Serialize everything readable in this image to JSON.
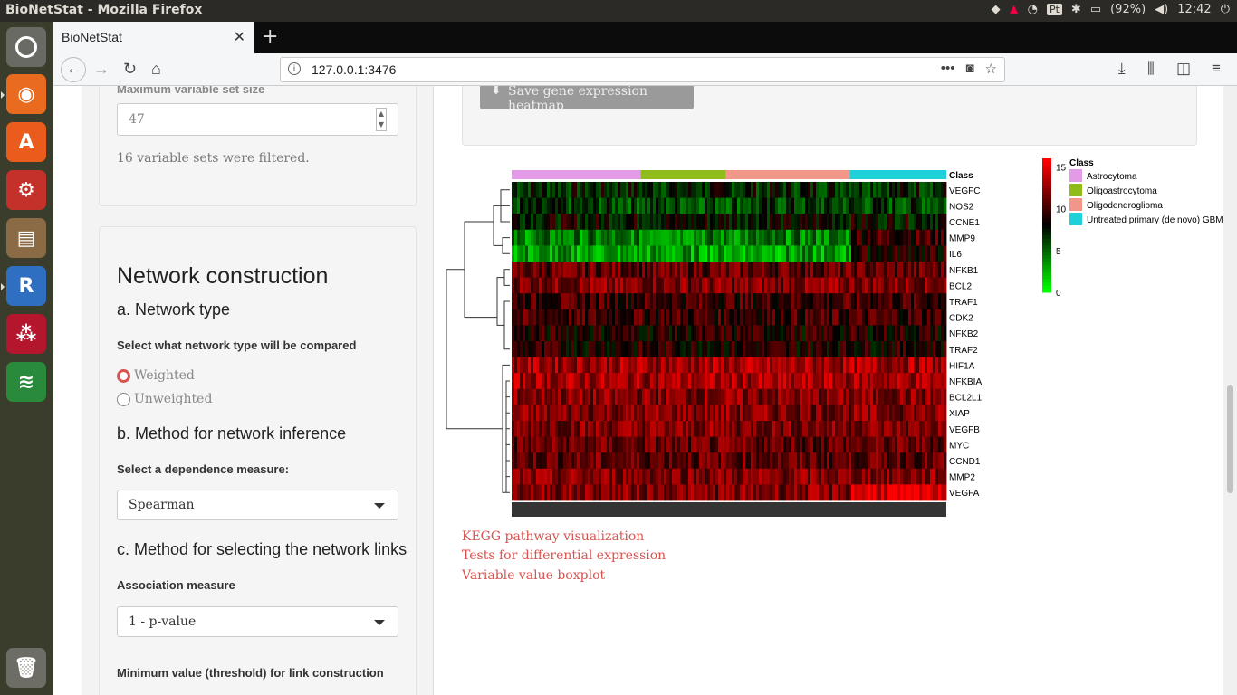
{
  "os": {
    "window_title": "BioNetStat - Mozilla Firefox",
    "battery": "(92%)",
    "clock": "12:42",
    "launcher": [
      "ubuntu-dash",
      "firefox",
      "software-center",
      "system-settings",
      "files",
      "r",
      "mendeley",
      "spotify",
      "trash"
    ]
  },
  "browser": {
    "tab_title": "BioNetStat",
    "url": "127.0.0.1:3476"
  },
  "sidebar": {
    "max_set_size_label": "Maximum variable set size",
    "max_set_size_value": "47",
    "filtered_text": "16 variable sets were filtered.",
    "section_title": "Network construction",
    "network_type_heading": "a. Network type",
    "network_type_prompt": "Select what network type will be compared",
    "network_type_options": [
      "Weighted",
      "Unweighted"
    ],
    "network_type_selected": "Weighted",
    "inference_heading": "b. Method for network inference",
    "dependence_prompt": "Select a dependence measure:",
    "dependence_value": "Spearman",
    "links_heading": "c. Method for selecting the network links",
    "association_label": "Association measure",
    "association_value": "1 - p-value",
    "threshold_label": "Minimum value (threshold) for link construction"
  },
  "main": {
    "save_button": "Save gene expression heatmap",
    "links": [
      "KEGG pathway visualization",
      "Tests for differential expression",
      "Variable value boxplot"
    ]
  },
  "chart_data": {
    "type": "heatmap",
    "column_annotation_label": "Class",
    "rows": [
      "VEGFC",
      "NOS2",
      "CCNE1",
      "MMP9",
      "IL6",
      "NFKB1",
      "BCL2",
      "TRAF1",
      "CDK2",
      "NFKB2",
      "TRAF2",
      "HIF1A",
      "NFKBIA",
      "BCL2L1",
      "XIAP",
      "VEGFB",
      "MYC",
      "CCND1",
      "MMP2",
      "VEGFA"
    ],
    "row_mean_values": [
      7,
      6,
      8,
      4,
      3,
      11,
      12,
      10,
      10,
      9,
      9,
      13,
      13,
      12,
      12,
      12,
      11,
      11,
      12,
      12
    ],
    "classes": [
      {
        "name": "Astrocytoma",
        "color": "#e39be8",
        "fraction": 0.297
      },
      {
        "name": "Oligoastrocytoma",
        "color": "#8fbc1a",
        "fraction": 0.196
      },
      {
        "name": "Oligodendroglioma",
        "color": "#f2968a",
        "fraction": 0.285
      },
      {
        "name": "Untreated primary (de novo) GBM",
        "color": "#1ed0d9",
        "fraction": 0.222
      }
    ],
    "legend_title": "Class",
    "colorbar_ticks": [
      "15",
      "10",
      "5",
      "0"
    ],
    "colorbar_range": [
      0,
      16
    ],
    "colors": {
      "low": "#00ff00",
      "mid": "#000000",
      "high": "#ff0000"
    }
  }
}
